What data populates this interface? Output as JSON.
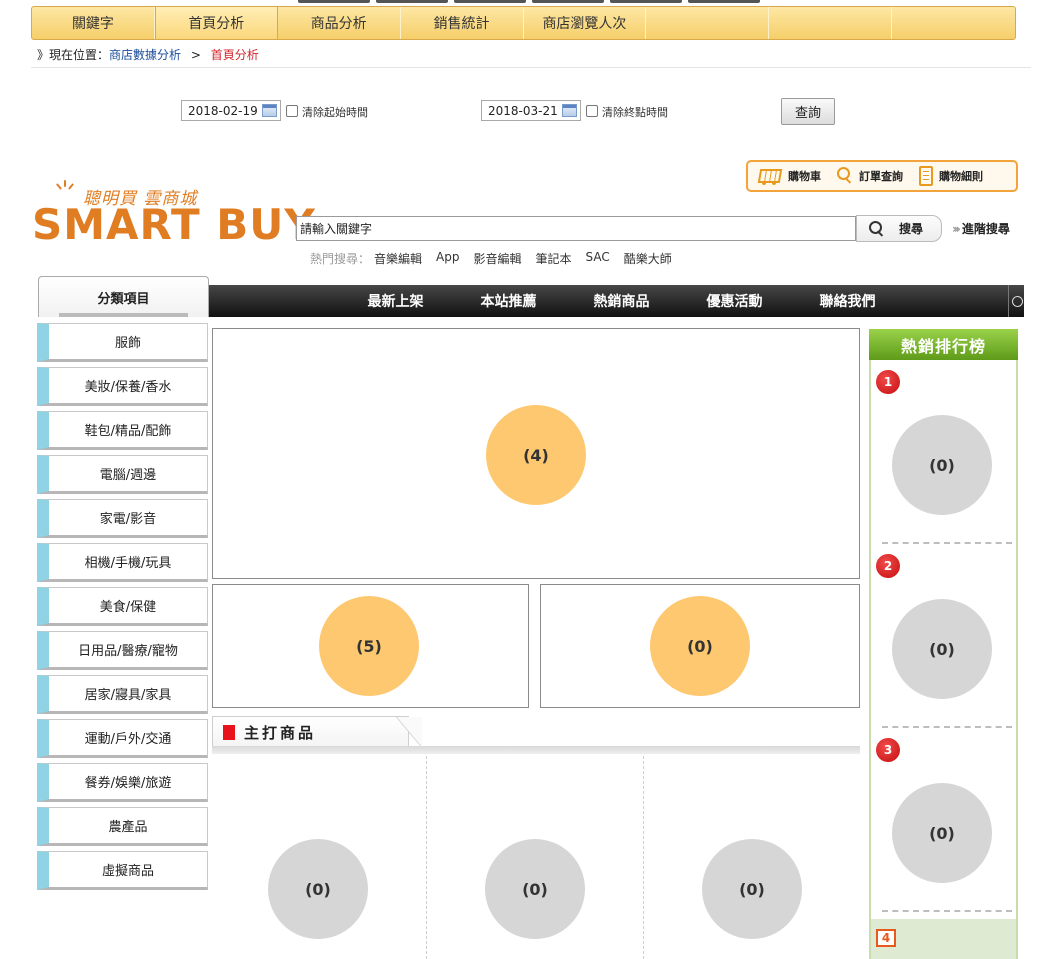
{
  "top_tabs": [
    "關鍵字",
    "首頁分析",
    "商品分析",
    "銷售統計",
    "商店瀏覽人次",
    "",
    "",
    ""
  ],
  "breadcrumb": {
    "prefix": "》現在位置：",
    "parent": "商店數據分析",
    "separator": ">",
    "current": "首頁分析"
  },
  "date_filter": {
    "start_date": "2018-02-19",
    "clear_start_label": "清除起始時間",
    "end_date": "2018-03-21",
    "clear_end_label": "清除終點時間",
    "query_button": "查詢"
  },
  "header_links": {
    "cart": "購物車",
    "order_query": "訂單查詢",
    "shopping_rules": "購物細則"
  },
  "logo": {
    "tagline": "聰明買 雲商城",
    "brand": "SMART BUY"
  },
  "search": {
    "value": "請輸入關鍵字",
    "button": "搜尋",
    "advanced": "進階搜尋",
    "hot_label": "熱門搜尋：",
    "hot_terms": [
      "音樂編輯",
      "App",
      "影音編輯",
      "筆記本",
      "SAC",
      "酷樂大師"
    ]
  },
  "category_header": "分類項目",
  "nav_items": [
    "最新上架",
    "本站推薦",
    "熱銷商品",
    "優惠活動",
    "聯絡我們"
  ],
  "categories": [
    "服飾",
    "美妝/保養/香水",
    "鞋包/精品/配飾",
    "電腦/週邊",
    "家電/影音",
    "相機/手機/玩具",
    "美食/保健",
    "日用品/醫療/寵物",
    "居家/寢具/家具",
    "運動/戶外/交通",
    "餐券/娛樂/旅遊",
    "農產品",
    "虛擬商品"
  ],
  "banners": {
    "main": "(4)",
    "left": "(5)",
    "right": "(0)"
  },
  "featured": {
    "title": "主打商品",
    "items": [
      "(0)",
      "(0)",
      "(0)"
    ]
  },
  "ranking": {
    "title": "熱銷排行榜",
    "ranks": [
      "1",
      "2",
      "3",
      "4"
    ],
    "items": [
      "(0)",
      "(0)",
      "(0)"
    ]
  },
  "colors": {
    "tab_bar": "#f6cf6a",
    "brand_orange": "#e07d22",
    "banner_orange": "#fec870",
    "placeholder_gray": "#d6d6d6",
    "rank_green": "#5e9b19",
    "category_accent": "#8fd3e4"
  }
}
